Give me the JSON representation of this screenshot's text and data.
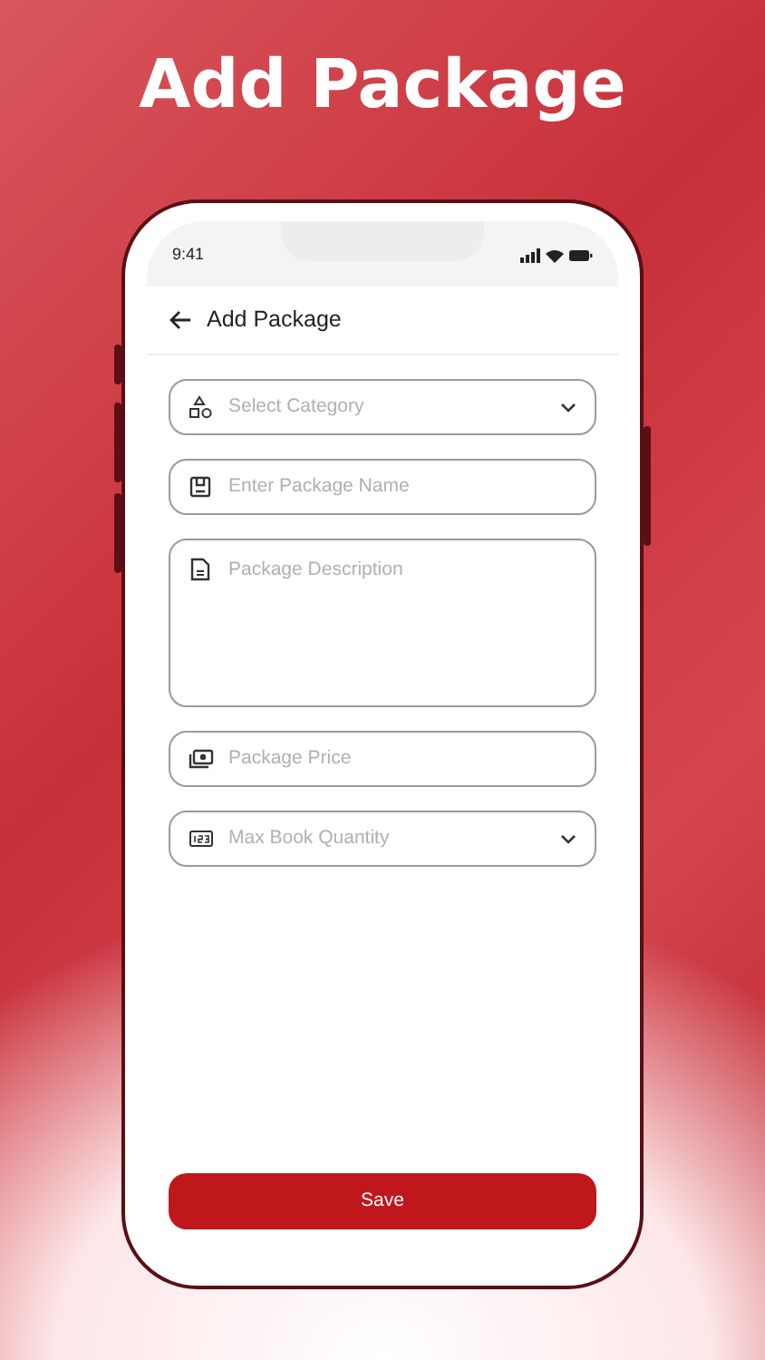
{
  "headline": "Add Package",
  "status_bar": {
    "time": "9:41"
  },
  "header": {
    "title": "Add Package"
  },
  "fields": [
    {
      "kind": "select",
      "placeholder": "Select Category"
    },
    {
      "kind": "text",
      "placeholder": "Enter Package Name"
    },
    {
      "kind": "textarea",
      "placeholder": "Package Description"
    },
    {
      "kind": "text",
      "placeholder": "Package Price"
    },
    {
      "kind": "select",
      "placeholder": "Max Book Quantity"
    }
  ],
  "save_button": {
    "label": "Save"
  }
}
